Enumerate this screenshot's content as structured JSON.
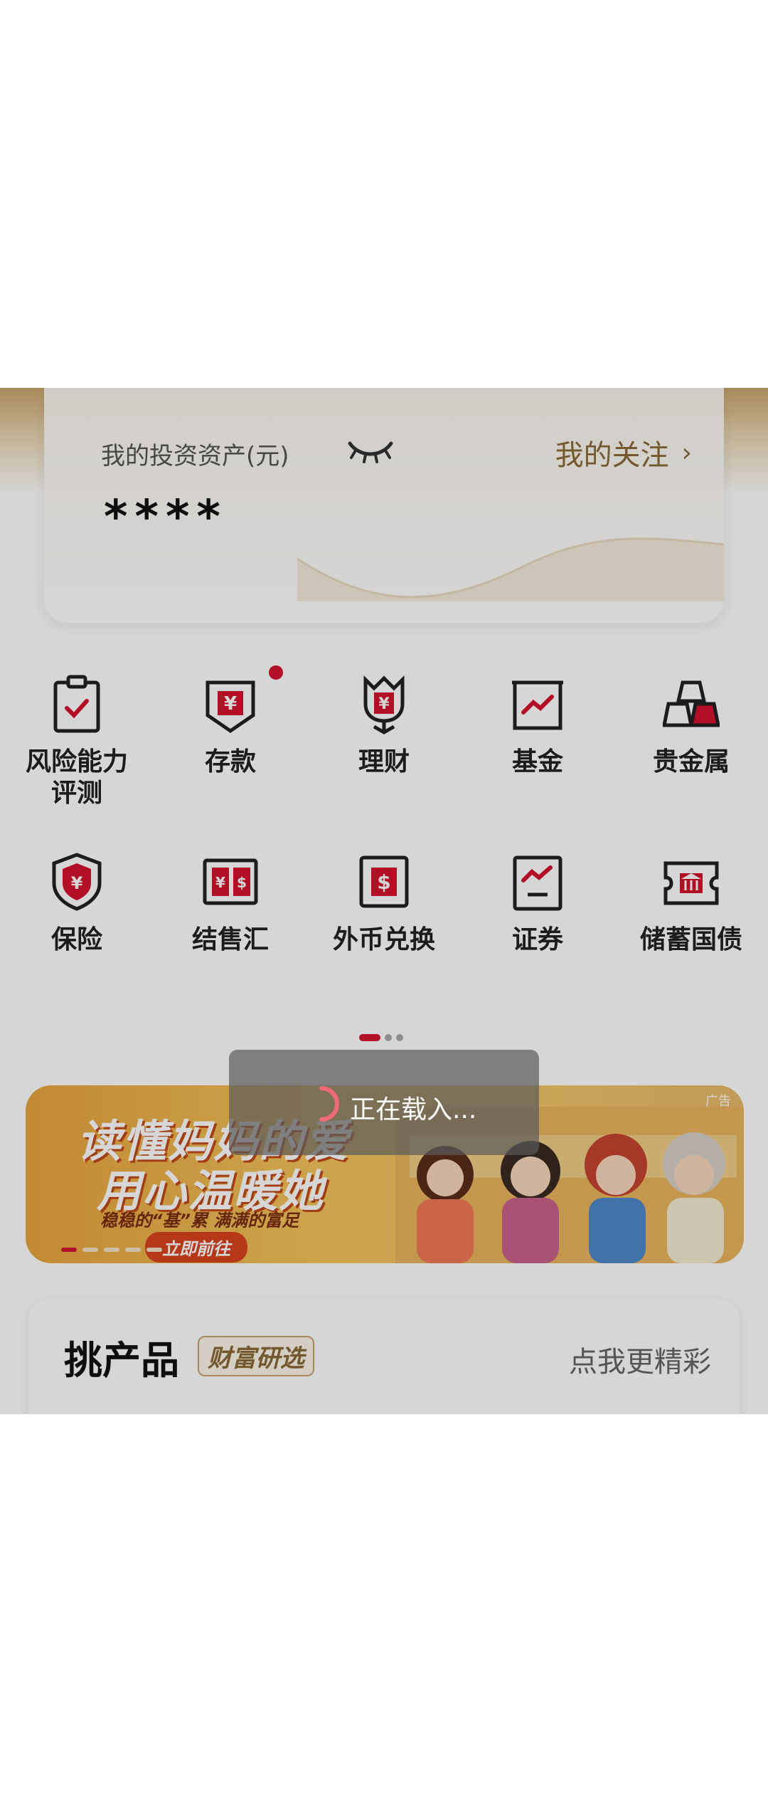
{
  "asset_card": {
    "label": "我的投资资产(元)",
    "value": "****",
    "follow_label": "我的关注",
    "follow_chevron": "›"
  },
  "quick_menu": [
    {
      "label": "风险能力\n评测",
      "icon": "clipboard-check-icon"
    },
    {
      "label": "存款",
      "icon": "yuan-deposit-icon",
      "badge": true
    },
    {
      "label": "理财",
      "icon": "flower-yuan-icon"
    },
    {
      "label": "基金",
      "icon": "chart-frame-icon"
    },
    {
      "label": "贵金属",
      "icon": "gold-bars-icon"
    },
    {
      "label": "保险",
      "icon": "shield-yuan-icon"
    },
    {
      "label": "结售汇",
      "icon": "currency-exchange-icon"
    },
    {
      "label": "外币兑换",
      "icon": "dollar-exchange-icon"
    },
    {
      "label": "证券",
      "icon": "stock-chart-icon"
    },
    {
      "label": "储蓄国债",
      "icon": "bank-ticket-icon"
    }
  ],
  "banner": {
    "headline1": "读懂妈妈的爱",
    "headline2": "用心温暖她",
    "subtitle": "稳稳的“基”累   满满的富足",
    "cta": "立即前往",
    "ad_label": "广告"
  },
  "products": {
    "title": "挑产品",
    "tag": "财富研选",
    "more": "点我更精彩"
  },
  "loading": {
    "text": "正在载入..."
  },
  "colors": {
    "accent_red": "#d4112d",
    "gold": "#8a6a36"
  }
}
